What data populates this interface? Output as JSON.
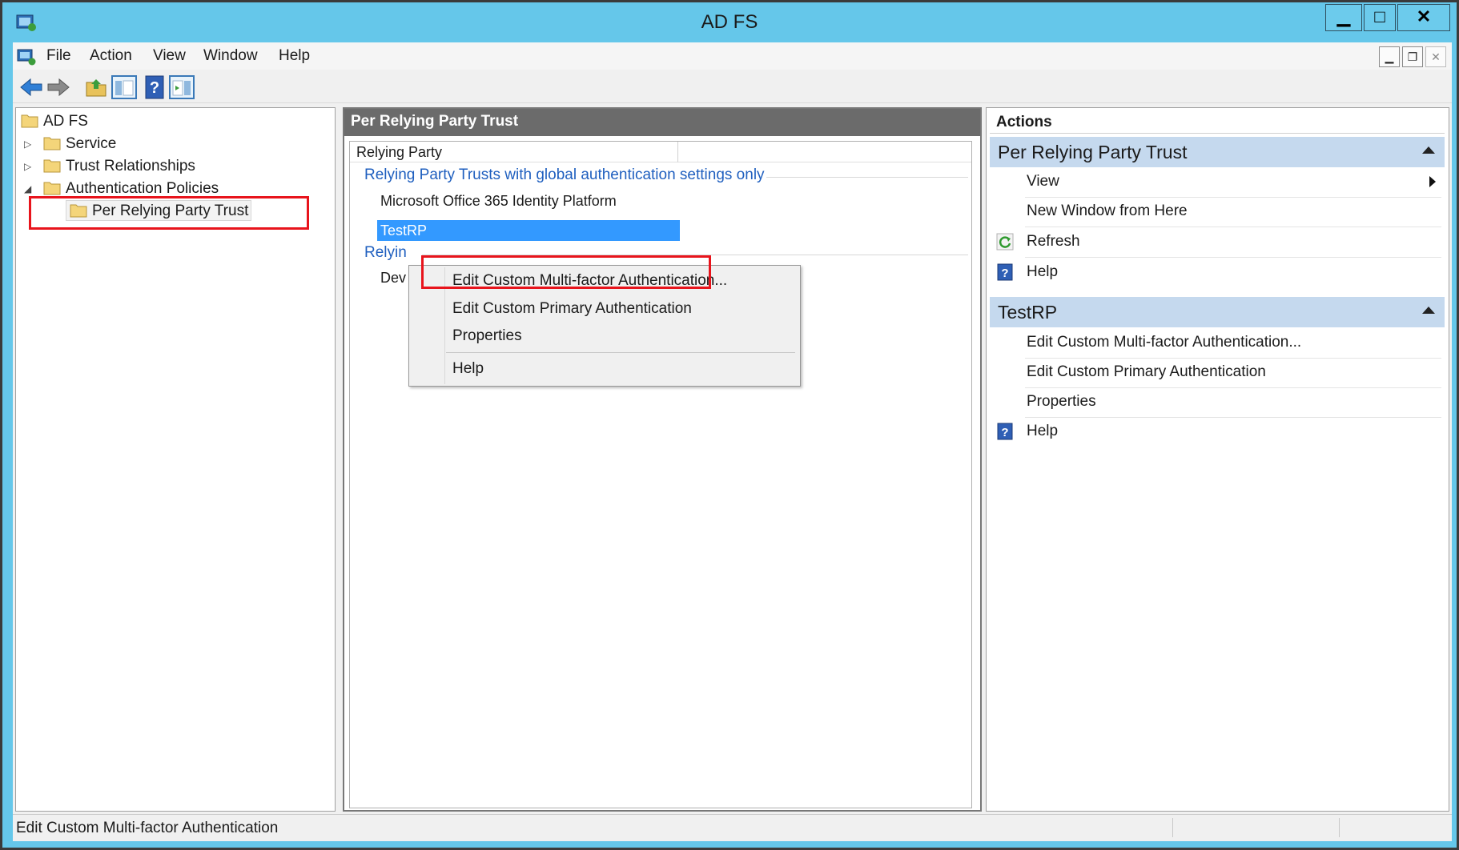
{
  "window": {
    "title": "AD FS",
    "minimize_label": "▁",
    "maximize_label": "□",
    "close_label": "✕"
  },
  "menubar": {
    "items": [
      "File",
      "Action",
      "View",
      "Window",
      "Help"
    ],
    "mdi": {
      "minimize": "▁",
      "restore": "❐",
      "close": "✕"
    }
  },
  "toolbar": {
    "buttons": [
      "back-arrow-icon",
      "forward-arrow-icon",
      "up-folder-icon",
      "show-hide-tree-icon",
      "help-icon",
      "show-hide-action-pane-icon"
    ]
  },
  "tree": {
    "root": "AD FS",
    "items": [
      {
        "label": "Service",
        "expander": "▷"
      },
      {
        "label": "Trust Relationships",
        "expander": "▷"
      },
      {
        "label": "Authentication Policies",
        "expander": "◢"
      },
      {
        "label": "Per Relying Party Trust",
        "expander": ""
      }
    ]
  },
  "center": {
    "header": "Per Relying Party Trust",
    "column": "Relying Party",
    "groups": [
      {
        "title": "Relying Party Trusts with global authentication settings only",
        "rows": [
          "Microsoft Office 365 Identity Platform",
          "TestRP"
        ]
      },
      {
        "title": "Relyin",
        "rows": [
          "Dev"
        ]
      }
    ]
  },
  "context_menu": {
    "items": [
      "Edit Custom Multi-factor Authentication...",
      "Edit Custom Primary Authentication",
      "Properties",
      "Help"
    ]
  },
  "actions": {
    "title": "Actions",
    "sections": [
      {
        "title": "Per Relying Party Trust",
        "items": [
          "View",
          "New Window from Here",
          "Refresh",
          "Help"
        ]
      },
      {
        "title": "TestRP",
        "items": [
          "Edit Custom Multi-factor Authentication...",
          "Edit Custom Primary Authentication",
          "Properties",
          "Help"
        ]
      }
    ]
  },
  "status": {
    "text": "Edit Custom Multi-factor Authentication"
  },
  "colors": {
    "titlebar": "#65c7ea",
    "highlight": "#e8141c",
    "selection": "#3399ff",
    "section_header": "#c5d9ee",
    "group_link": "#1f5fbf"
  }
}
